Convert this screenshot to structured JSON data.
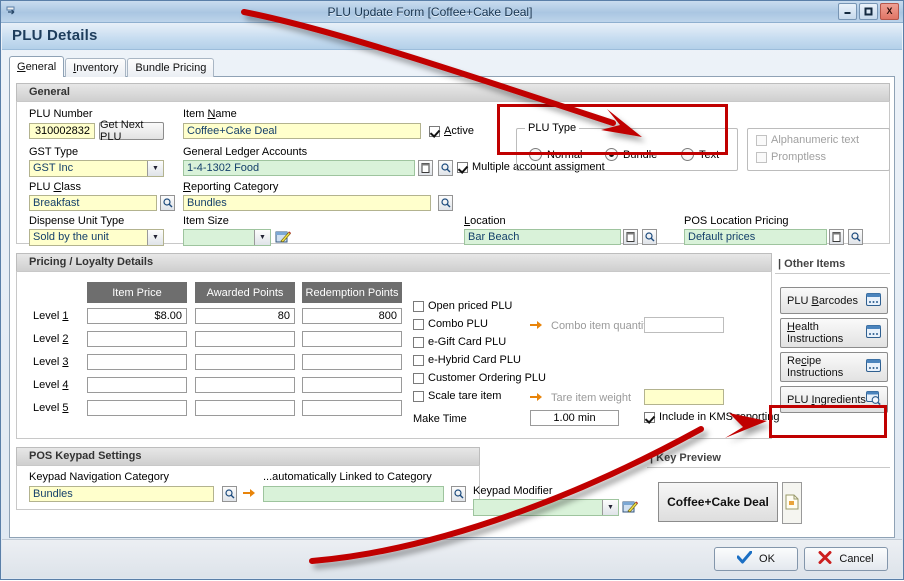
{
  "window": {
    "title": "PLU Update Form [Coffee+Cake Deal]",
    "minimize": "–",
    "maximize": "□",
    "close": "X",
    "header": "PLU Details"
  },
  "tabs": [
    {
      "label": "General",
      "active": true
    },
    {
      "label": "Inventory",
      "active": false
    },
    {
      "label": "Bundle Pricing",
      "active": false
    }
  ],
  "general": {
    "section_title": "General",
    "plu_number_label": "PLU Number",
    "plu_number_value": "310002832",
    "get_next_plu_label": "Get Next PLU",
    "item_name_label": "Item Name",
    "item_name_value": "Coffee+Cake Deal",
    "active_label": "Active",
    "gst_type_label": "GST Type",
    "gst_type_value": "GST Inc",
    "gl_accounts_label": "General Ledger Accounts",
    "gl_accounts_value": "1-4-1302  Food",
    "multiple_account_label": "Multiple account assigment",
    "plu_class_label": "PLU Class",
    "plu_class_value": "Breakfast",
    "reporting_category_label": "Reporting Category",
    "reporting_category_value": "Bundles",
    "dispense_unit_label": "Dispense Unit Type",
    "dispense_unit_value": "Sold by the unit",
    "item_size_label": "Item Size",
    "item_size_value": "",
    "location_label": "Location",
    "location_value": "Bar Beach",
    "pos_location_pricing_label": "POS Location Pricing",
    "pos_location_pricing_value": "Default prices",
    "plu_type_legend": "PLU Type",
    "plu_type_options": [
      "Normal",
      "Bundle",
      "Text"
    ],
    "plu_type_selected": "Bundle",
    "alphanumeric_label": "Alphanumeric text",
    "promptless_label": "Promptless"
  },
  "pricing": {
    "section_title": "Pricing / Loyalty Details",
    "columns": [
      "Item Price",
      "Awarded Points",
      "Redemption Points"
    ],
    "rows": [
      {
        "label": "Level 1",
        "item_price": "$8.00",
        "awarded_points": "80",
        "redemption_points": "800"
      },
      {
        "label": "Level 2",
        "item_price": "",
        "awarded_points": "",
        "redemption_points": ""
      },
      {
        "label": "Level 3",
        "item_price": "",
        "awarded_points": "",
        "redemption_points": ""
      },
      {
        "label": "Level 4",
        "item_price": "",
        "awarded_points": "",
        "redemption_points": ""
      },
      {
        "label": "Level 5",
        "item_price": "",
        "awarded_points": "",
        "redemption_points": ""
      }
    ],
    "checkboxes": [
      {
        "label": "Open priced PLU",
        "checked": false
      },
      {
        "label": "Combo PLU",
        "checked": false
      },
      {
        "label": "e-Gift Card PLU",
        "checked": false
      },
      {
        "label": "e-Hybrid Card PLU",
        "checked": false
      },
      {
        "label": "Customer Ordering PLU",
        "checked": false
      },
      {
        "label": "Scale tare item",
        "checked": false
      }
    ],
    "combo_item_quantity_label": "Combo item quantity",
    "combo_item_quantity_value": "",
    "tare_item_weight_label": "Tare item weight",
    "tare_item_weight_value": "",
    "make_time_label": "Make Time",
    "make_time_value": "1.00 min",
    "kms_label": "Include in KMS reporting",
    "kms_checked": true
  },
  "other_items": {
    "section_title": "| Other Items",
    "buttons": [
      {
        "label": "PLU Barcodes",
        "icon": "window-icon"
      },
      {
        "label": "Health\nInstructions",
        "icon": "window-icon"
      },
      {
        "label": "Recipe\nInstructions",
        "icon": "window-icon"
      },
      {
        "label": "PLU Ingredients",
        "icon": "window-search-icon"
      }
    ]
  },
  "keypad": {
    "section_title": "POS Keypad Settings",
    "nav_category_label": "Keypad Navigation Category",
    "nav_category_value": "Bundles",
    "linked_category_label": "...automatically Linked to Category",
    "linked_category_value": "",
    "modifier_label": "Keypad Modifier",
    "modifier_value": ""
  },
  "key_preview": {
    "section_title": "| Key Preview",
    "button_label": "Coffee+Cake Deal"
  },
  "footer": {
    "ok_label": "OK",
    "cancel_label": "Cancel"
  },
  "colors": {
    "highlight": "#c00000",
    "title_text": "#16334f",
    "field_yellow": "#ffffcc",
    "field_green": "#d9f2d9",
    "column_header": "#6e6e6e"
  }
}
